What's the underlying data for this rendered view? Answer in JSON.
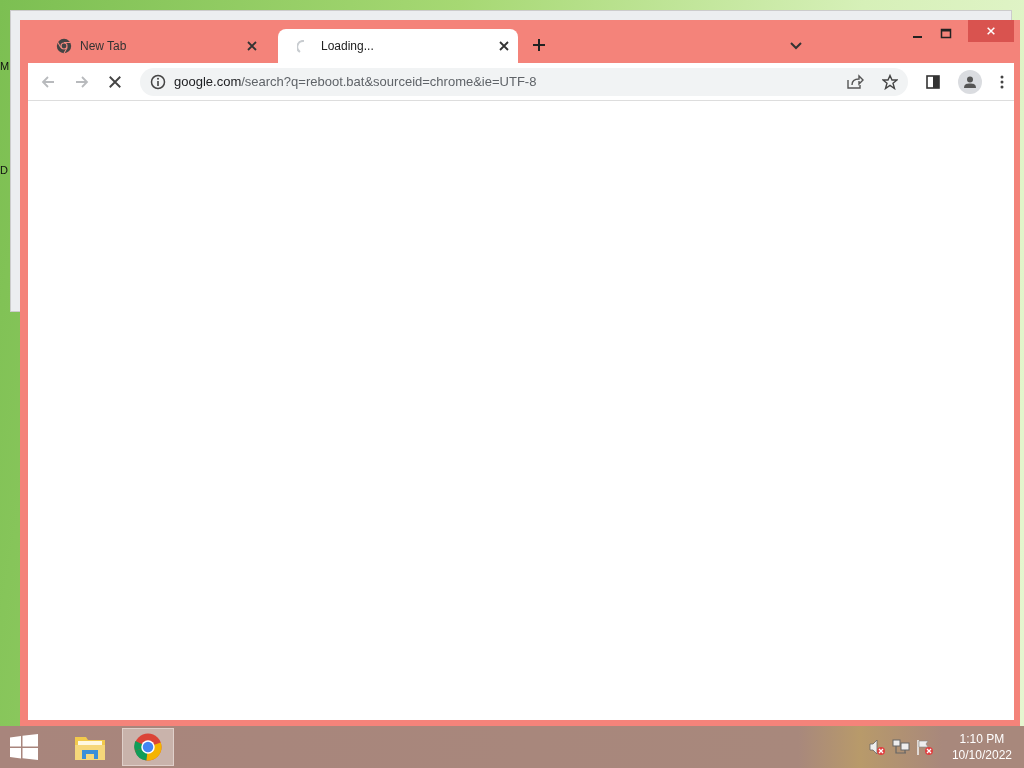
{
  "desktop": {
    "icon_labels": [
      "M",
      "D"
    ]
  },
  "browser": {
    "loading": true,
    "tabs": [
      {
        "title": "New Tab",
        "selected": false,
        "loading": false
      },
      {
        "title": "Loading...",
        "selected": true,
        "loading": true
      }
    ],
    "address": {
      "host": "google.com",
      "path": "/search?q=reboot.bat&sourceid=chrome&ie=UTF-8"
    }
  },
  "taskbar": {
    "apps": [
      {
        "kind": "explorer",
        "selected": false
      },
      {
        "kind": "chrome",
        "selected": true
      }
    ],
    "time": "1:10 PM",
    "date": "10/10/2022"
  }
}
